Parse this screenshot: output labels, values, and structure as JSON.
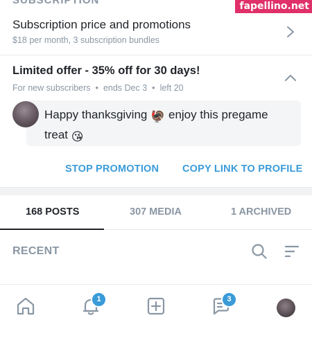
{
  "section_header": "SUBSCRIPTION",
  "watermark": "fapellino.net",
  "subscription": {
    "title": "Subscription price and promotions",
    "detail": "$18 per month, 3 subscription bundles"
  },
  "offer": {
    "title": "Limited offer - 35% off for 30 days!",
    "audience": "For new subscribers",
    "ends": "ends Dec 3",
    "left": "left 20",
    "separator": "•"
  },
  "message": {
    "text_before": "Happy thanksgiving ",
    "emoji_1": "🦃",
    "text_middle": " enjoy this pregame treat ",
    "emoji_2": "😘"
  },
  "actions": {
    "stop_label": "STOP PROMOTION",
    "copy_label": "COPY LINK TO PROFILE"
  },
  "tabs": [
    {
      "label": "168 POSTS",
      "active": true
    },
    {
      "label": "307 MEDIA",
      "active": false
    },
    {
      "label": "1 ARCHIVED",
      "active": false
    }
  ],
  "recent": {
    "label": "RECENT"
  },
  "nav": {
    "notifications_badge": "1",
    "messages_badge": "3"
  },
  "colors": {
    "accent": "#3a9bd9",
    "muted": "#8a96a3",
    "text": "#1f2328",
    "watermark_bg": "#e0306a"
  }
}
